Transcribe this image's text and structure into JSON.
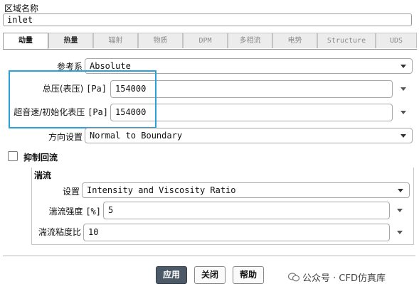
{
  "zone": {
    "label": "区域名称",
    "value": "inlet"
  },
  "tabs": [
    {
      "label": "动量",
      "active": true
    },
    {
      "label": "热量"
    },
    {
      "label": "辐射"
    },
    {
      "label": "物质"
    },
    {
      "label": "DPM"
    },
    {
      "label": "多相流"
    },
    {
      "label": "电势"
    },
    {
      "label": "Structure"
    },
    {
      "label": "UDS"
    }
  ],
  "momentum": {
    "reference_frame": {
      "label": "参考系",
      "value": "Absolute"
    },
    "total_pressure": {
      "label": "总压(表压)",
      "unit": "[Pa]",
      "value": "154000"
    },
    "supersonic_pressure": {
      "label": "超音速/初始化表压",
      "unit": "[Pa]",
      "value": "154000"
    },
    "direction": {
      "label": "方向设置",
      "value": "Normal to Boundary"
    },
    "prevent_backflow": {
      "label": "抑制回流",
      "checked": false
    }
  },
  "turbulence": {
    "title": "湍流",
    "method": {
      "label": "设置",
      "value": "Intensity and Viscosity Ratio"
    },
    "intensity": {
      "label": "湍流强度",
      "unit": "[%]",
      "value": "5"
    },
    "viscosity_ratio": {
      "label": "湍流粘度比",
      "value": "10"
    }
  },
  "buttons": {
    "apply": "应用",
    "close": "关闭",
    "help": "帮助"
  },
  "watermark": {
    "text": "公众号 · CFD仿真库"
  },
  "colors": {
    "highlight": "#2aa0dc",
    "primary_button": "#4c5a68"
  }
}
